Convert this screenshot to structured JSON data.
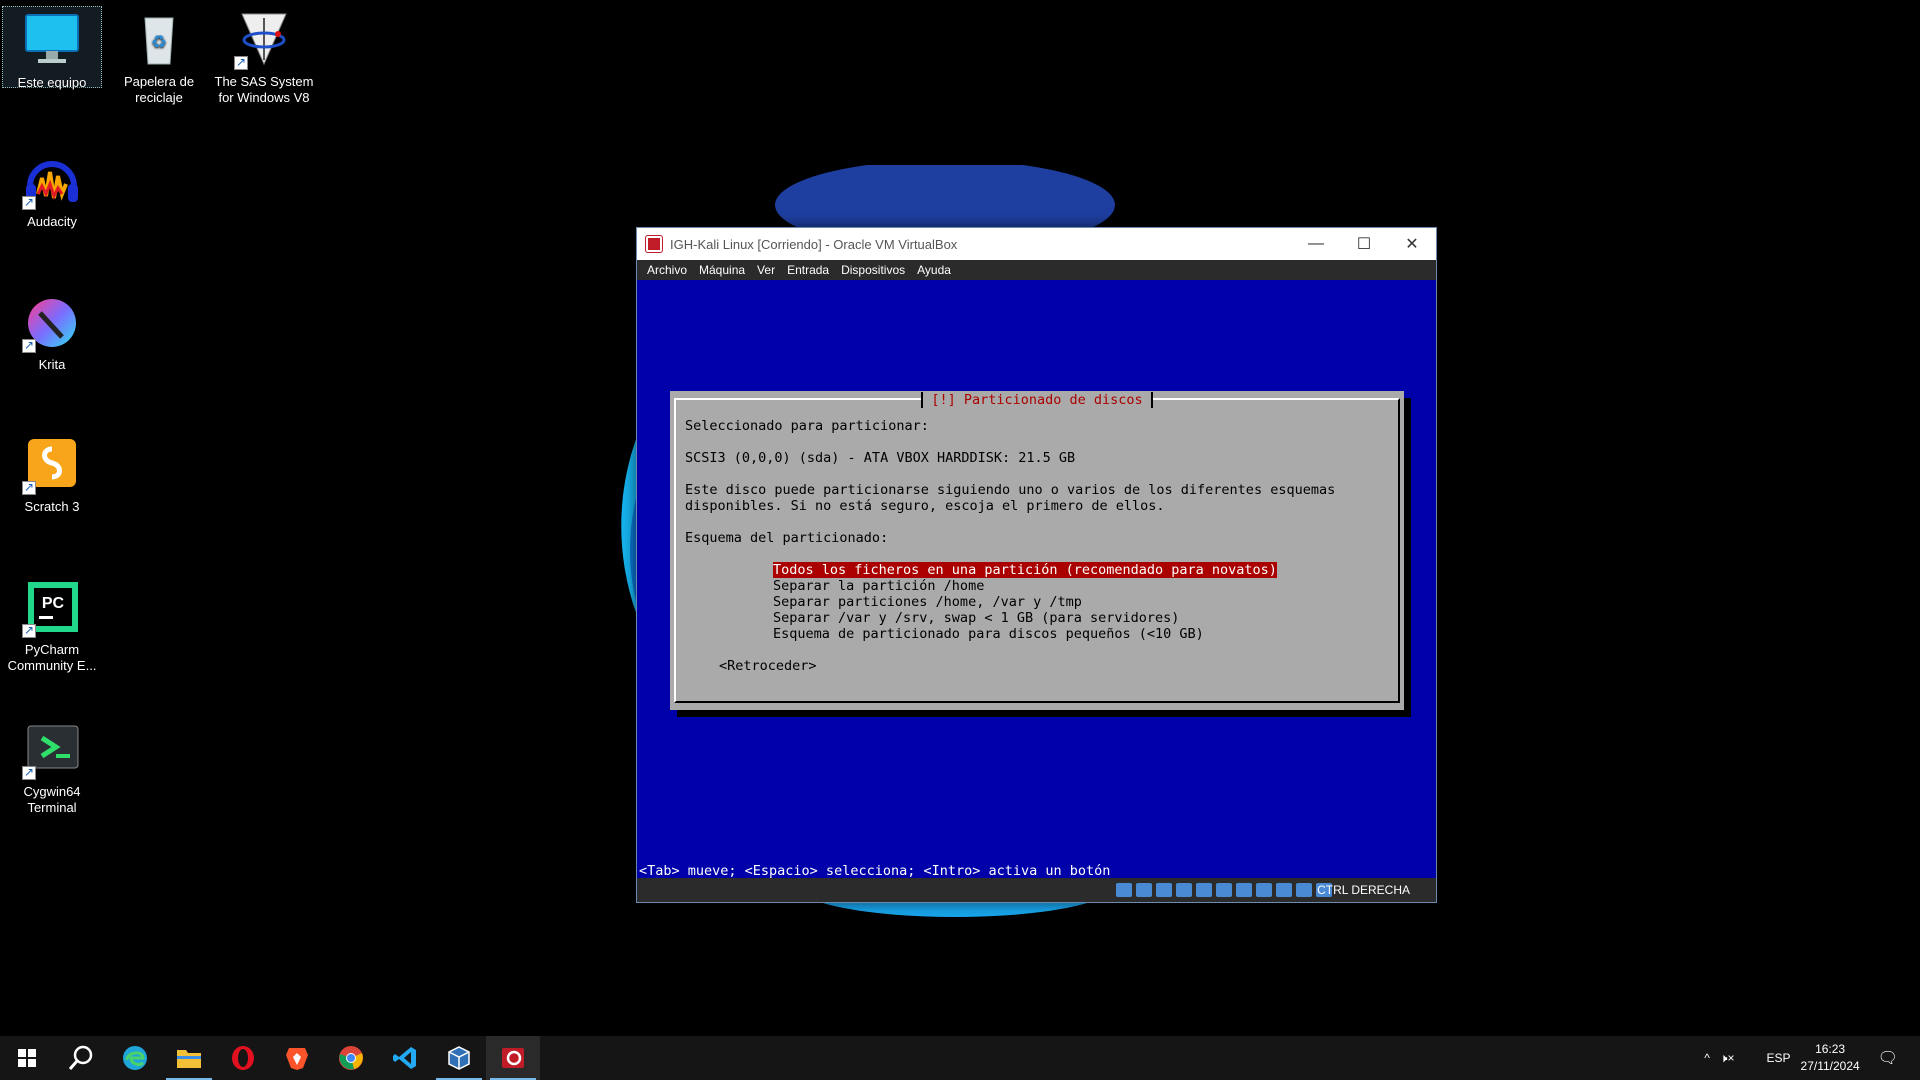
{
  "desktop": {
    "icons": [
      {
        "label": "Este equipo",
        "icon": "monitor-icon"
      },
      {
        "label": "Papelera de reciclaje",
        "icon": "recycle-bin-icon"
      },
      {
        "label": "The SAS System for Windows V8",
        "icon": "sas-icon"
      },
      {
        "label": "Audacity",
        "icon": "audacity-icon"
      },
      {
        "label": "Krita",
        "icon": "krita-icon"
      },
      {
        "label": "Scratch 3",
        "icon": "scratch-icon"
      },
      {
        "label": "PyCharm Community E...",
        "icon": "pycharm-icon"
      },
      {
        "label": "Cygwin64 Terminal",
        "icon": "cygwin-icon"
      }
    ]
  },
  "vbox": {
    "title": "IGH-Kali Linux [Corriendo] - Oracle VM VirtualBox",
    "menu": [
      "Archivo",
      "Máquina",
      "Ver",
      "Entrada",
      "Dispositivos",
      "Ayuda"
    ],
    "installer": {
      "title": "[!] Particionado de discos",
      "selected_label": "Seleccionado para particionar:",
      "disk": "SCSI3 (0,0,0) (sda) - ATA VBOX HARDDISK: 21.5 GB",
      "desc_line1": "Este disco puede particionarse siguiendo uno o varios de los diferentes esquemas",
      "desc_line2": "disponibles. Si no está seguro, escoja el primero de ellos.",
      "scheme_label": "Esquema del particionado:",
      "options": [
        "Todos los ficheros en una partición (recomendado para novatos)",
        "Separar la partición /home",
        "Separar particiones /home, /var y /tmp",
        "Separar /var y /srv, swap < 1 GB (para servidores)",
        "Esquema de particionado para discos pequeños (<10 GB)"
      ],
      "back_button": "<Retroceder>",
      "hint": "<Tab> mueve; <Espacio> selecciona; <Intro> activa un botón"
    },
    "host_key": "CTRL DERECHA"
  },
  "taskbar": {
    "apps": [
      "start-icon",
      "search-icon",
      "edge-icon",
      "file-explorer-icon",
      "opera-icon",
      "brave-icon",
      "chrome-icon",
      "vscode-icon",
      "virtualbox-icon",
      "kali-vm-icon"
    ],
    "language": "ESP",
    "time": "16:23",
    "date": "27/11/2024"
  },
  "colors": {
    "vm_background": "#0000aa",
    "dialog_gray": "#aaaaaa",
    "selection_red": "#aa0000"
  }
}
